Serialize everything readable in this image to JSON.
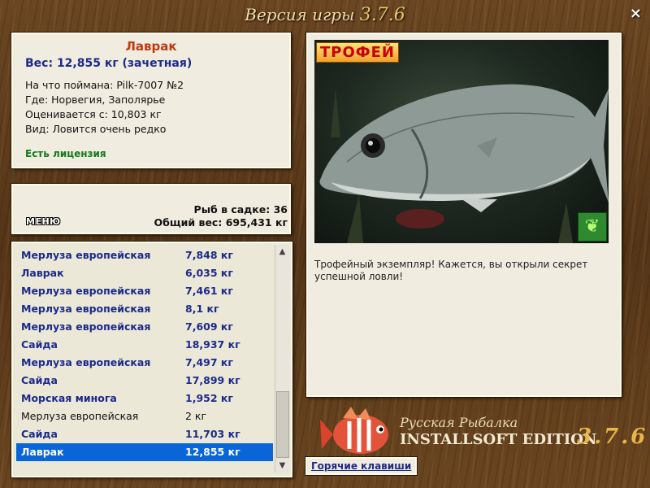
{
  "window": {
    "title": "Версия игры",
    "version": "3.7.6",
    "close_label": "×"
  },
  "info": {
    "fish_name": "Лаврак",
    "weight": "Вес: 12,855 кг (зачетная)",
    "caught_on": "На что поймана: Pilk-7007 №2",
    "where": "Где: Норвегия, Заполярье",
    "rated_from": "Оценивается с: 10,803 кг",
    "kind": "Вид: Ловится очень редко",
    "license": "Есть лицензия"
  },
  "keepnet": {
    "menu_label": "МЕНЮ",
    "fish_count": "Рыб в садке: 36",
    "total_weight": "Общий вес: 695,431 кг"
  },
  "catch_list": {
    "rows": [
      {
        "name": "Мерлуза европейская",
        "weight": "7,848 кг",
        "style": "bold"
      },
      {
        "name": "Лаврак",
        "weight": "6,035 кг",
        "style": "bold"
      },
      {
        "name": "Мерлуза европейская",
        "weight": "7,461 кг",
        "style": "bold"
      },
      {
        "name": "Мерлуза европейская",
        "weight": "8,1 кг",
        "style": "bold"
      },
      {
        "name": "Мерлуза европейская",
        "weight": "7,609 кг",
        "style": "bold"
      },
      {
        "name": "Сайда",
        "weight": "18,937 кг",
        "style": "bold"
      },
      {
        "name": "Мерлуза европейская",
        "weight": "7,497 кг",
        "style": "bold"
      },
      {
        "name": "Сайда",
        "weight": "17,899 кг",
        "style": "bold"
      },
      {
        "name": "Морская минога",
        "weight": "1,952 кг",
        "style": "bold"
      },
      {
        "name": "Мерлуза европейская",
        "weight": "2 кг",
        "style": "plain"
      },
      {
        "name": "Сайда",
        "weight": "11,703 кг",
        "style": "bold"
      },
      {
        "name": "Лаврак",
        "weight": "12,855 кг",
        "style": "selected"
      }
    ]
  },
  "trophy": {
    "badge": "ТРОФЕЙ",
    "description": "Трофейный экземпляр! Кажется, вы открыли секрет успешной ловли!",
    "butterfly_icon": "butterfly-icon"
  },
  "branding": {
    "line1": "Русская Рыбалка",
    "line2": "INSTALLSOFT EDITION",
    "version": "3.7.6"
  },
  "hotkeys_label": "Горячие клавиши",
  "colors": {
    "selected_row": "#0a66d8",
    "name_red": "#c03a10",
    "weight_blue": "#1c2a8a",
    "license_green": "#157a1e"
  }
}
